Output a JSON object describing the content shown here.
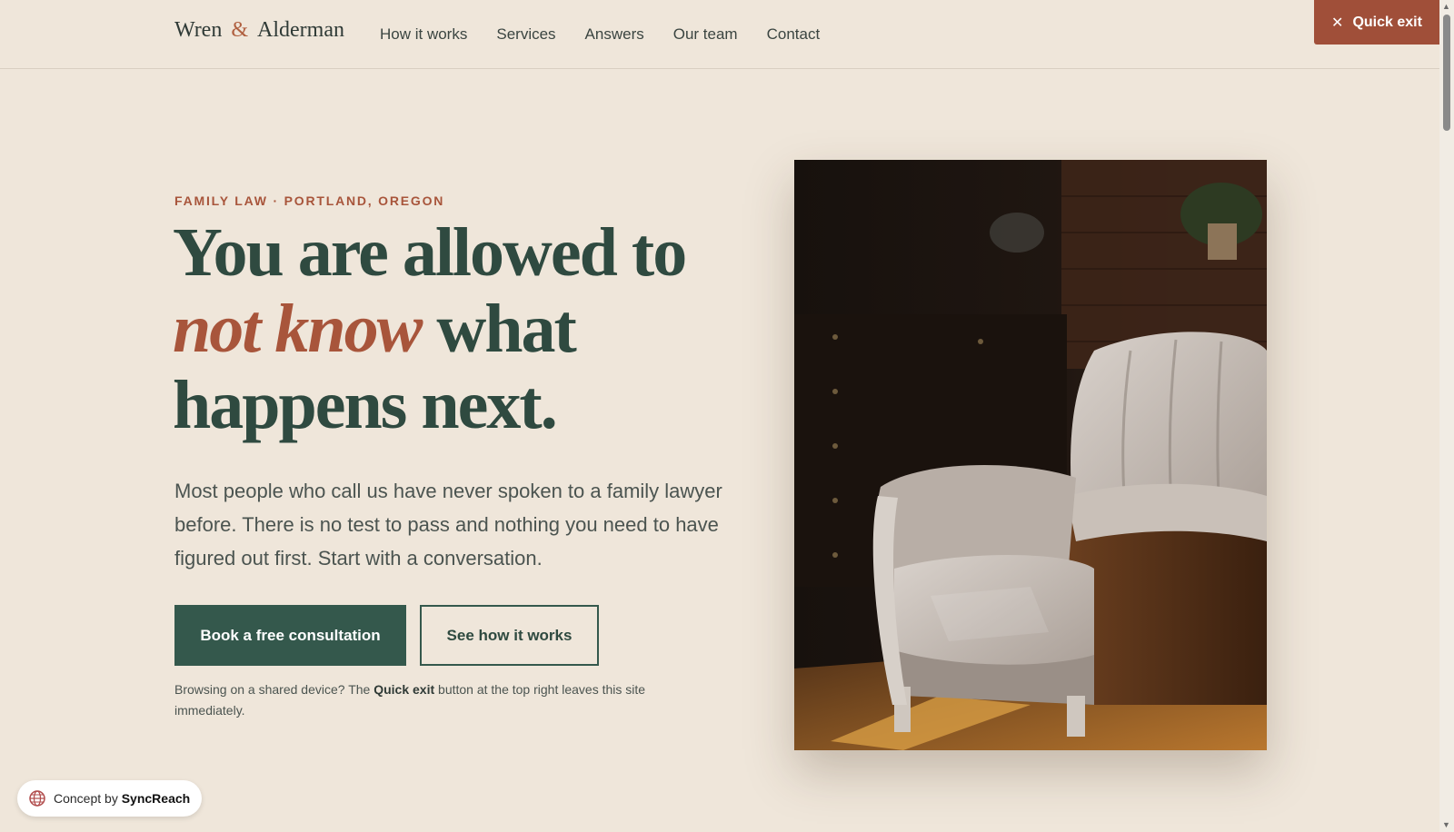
{
  "brand": {
    "name_left": "Wren",
    "amp": "&",
    "name_right": "Alderman"
  },
  "nav": {
    "items": [
      {
        "label": "How it works"
      },
      {
        "label": "Services"
      },
      {
        "label": "Answers"
      },
      {
        "label": "Our team"
      },
      {
        "label": "Contact"
      }
    ]
  },
  "quick_exit": {
    "label": "Quick exit",
    "icon": "close-icon"
  },
  "hero": {
    "eyebrow": "FAMILY LAW · PORTLAND, OREGON",
    "headline_line1": "You are allowed to",
    "headline_emphasis": "not know",
    "headline_line2_rest": " what",
    "headline_line3": "happens next.",
    "lede": "Most people who call us have never spoken to a family lawyer before. There is no test to pass and nothing you need to have figured out first. Start with a conversation.",
    "primary_cta": "Book a free consultation",
    "secondary_cta": "See how it works",
    "note_before": "Browsing on a shared device? The ",
    "note_bold": "Quick exit",
    "note_after": " button at the top right leaves this site immediately."
  },
  "photo": {
    "subject": "armchair-photo"
  },
  "badge": {
    "prefix": "Concept by ",
    "brand": "SyncReach",
    "icon": "globe-icon"
  },
  "colors": {
    "background": "#efe6da",
    "accent": "#a8553b",
    "primary": "#34584c",
    "quick_exit": "#a04f39"
  }
}
